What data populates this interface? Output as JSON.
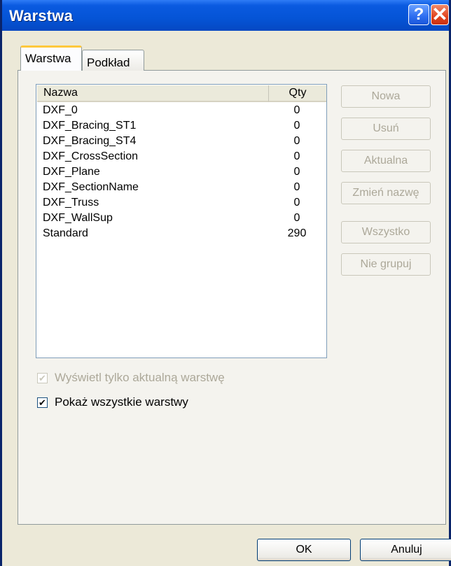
{
  "window": {
    "title": "Warstwa"
  },
  "title_buttons": {
    "help": "?",
    "close": "✕"
  },
  "tabs": [
    {
      "label": "Warstwa",
      "active": true
    },
    {
      "label": "Podkład",
      "active": false
    }
  ],
  "list": {
    "columns": [
      "Nazwa",
      "Qty"
    ],
    "rows": [
      {
        "name": "DXF_0",
        "qty": "0"
      },
      {
        "name": "DXF_Bracing_ST1",
        "qty": "0"
      },
      {
        "name": "DXF_Bracing_ST4",
        "qty": "0"
      },
      {
        "name": "DXF_CrossSection",
        "qty": "0"
      },
      {
        "name": "DXF_Plane",
        "qty": "0"
      },
      {
        "name": "DXF_SectionName",
        "qty": "0"
      },
      {
        "name": "DXF_Truss",
        "qty": "0"
      },
      {
        "name": "DXF_WallSup",
        "qty": "0"
      },
      {
        "name": "Standard",
        "qty": "290"
      }
    ]
  },
  "side_buttons": {
    "new": "Nowa",
    "delete": "Usuń",
    "current": "Aktualna",
    "rename": "Zmień nazwę",
    "all": "Wszystko",
    "ungroup": "Nie grupuj"
  },
  "checkboxes": {
    "show_current_only": {
      "label": "Wyświetl tylko aktualną warstwę",
      "checked": true,
      "enabled": false
    },
    "show_all": {
      "label": "Pokaż wszystkie warstwy",
      "checked": true,
      "enabled": true
    }
  },
  "footer": {
    "ok": "OK",
    "cancel": "Anuluj"
  },
  "check_glyph": "✔"
}
